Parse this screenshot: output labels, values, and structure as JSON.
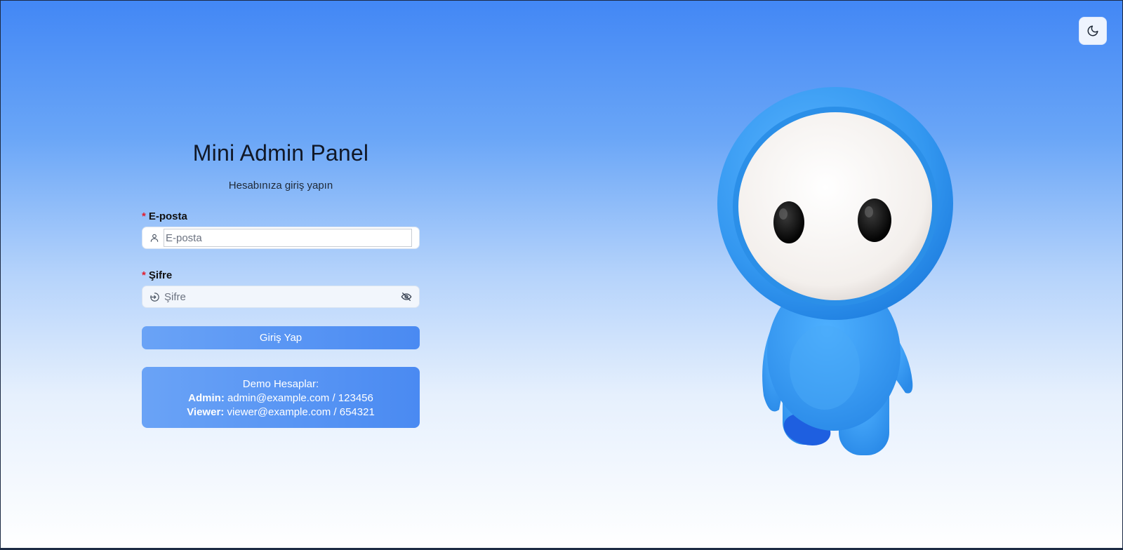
{
  "app": {
    "title": "Mini Admin Panel",
    "subtitle": "Hesabınıza giriş yapın"
  },
  "theme_toggle": {
    "icon": "moon-icon"
  },
  "form": {
    "email": {
      "label": "E-posta",
      "placeholder": "E-posta",
      "value": "",
      "icon": "user-icon"
    },
    "password": {
      "label": "Şifre",
      "placeholder": "Şifre",
      "value": "",
      "icon": "login-icon",
      "toggle_icon": "eye-off-icon"
    },
    "submit_label": "Giriş Yap"
  },
  "demo": {
    "heading": "Demo Hesaplar:",
    "accounts": [
      {
        "role": "Admin:",
        "credentials": "admin@example.com / 123456"
      },
      {
        "role": "Viewer:",
        "credentials": "viewer@example.com / 654321"
      }
    ]
  },
  "colors": {
    "accent": "#4a8af2",
    "required": "#e11d2e",
    "bg_top": "#4287f5",
    "mascot_blue": "#3a9cf2"
  }
}
